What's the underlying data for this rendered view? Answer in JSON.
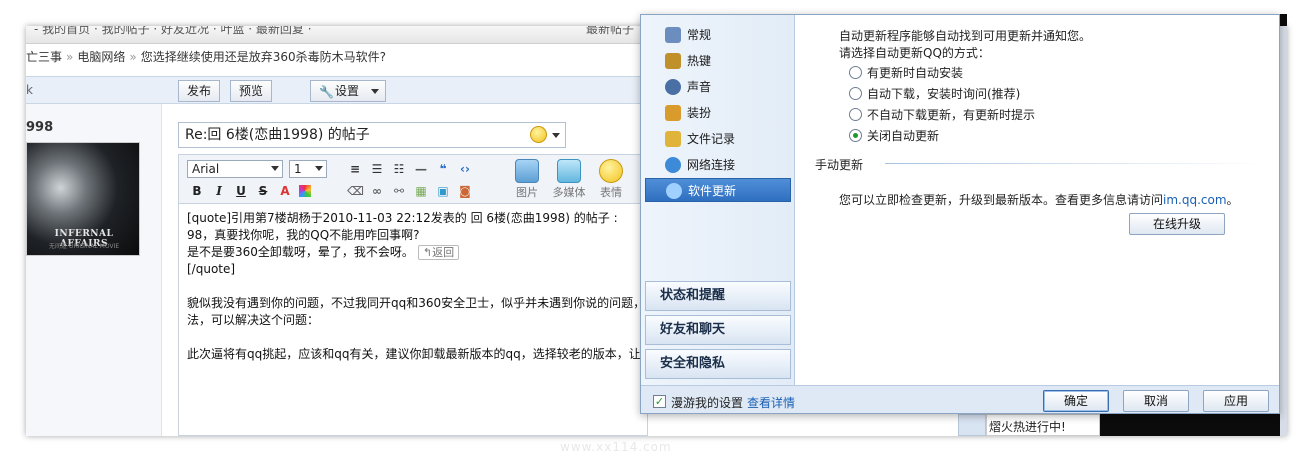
{
  "browser": {
    "topbar_text": "- 我的首页 · 我的帖子 · 好友近况 · 叶蓝 · 最新回复 ·",
    "topbar_right": "最新帖子"
  },
  "forum": {
    "breadcrumb": [
      "亡三事",
      "电脑网络",
      "您选择继续使用还是放弃360杀毒防木马软件?"
    ],
    "buttons": {
      "publish": "发布",
      "preview": "预览",
      "settings": "设置"
    },
    "left_marker": "k",
    "username": "998",
    "avatar_caption": "INFERNAL AFFAIRS",
    "avatar_sub": "无间道 ORIGINAL MOVIE",
    "subject": "Re:回 6楼(恋曲1998) 的帖子",
    "font_name": "Arial",
    "font_size": "1",
    "rich_icons": {
      "image": "图片",
      "media": "多媒体",
      "emoji": "表情"
    },
    "content_lines": [
      "[quote]引用第7楼胡杨于2010-11-03 22:12发表的 回 6楼(恋曲1998) 的帖子 :",
      "98，真要找你呢，我的QQ不能用咋回事啊?",
      "是不是要360全卸载呀，晕了，我不会呀。",
      "[/quote]",
      "",
      "貌似我没有遇到你的问题，不过我同开qq和360安全卫士，似乎并未遇到你说的问题，",
      "法，可以解决这个问题：",
      "",
      "此次逼将有qq挑起，应该和qq有关，建议你卸载最新版本的qq，选择较老的版本，让后"
    ],
    "back_label": "返回"
  },
  "dialog": {
    "nav_items": [
      {
        "label": "常规",
        "icon": "general-icon",
        "color": "#6c8ebf"
      },
      {
        "label": "热键",
        "icon": "hotkey-icon",
        "color": "#c0902a"
      },
      {
        "label": "声音",
        "icon": "sound-icon",
        "color": "#4a6fa5"
      },
      {
        "label": "装扮",
        "icon": "dress-icon",
        "color": "#d99b2b"
      },
      {
        "label": "文件记录",
        "icon": "folder-icon",
        "color": "#e0b33b"
      },
      {
        "label": "网络连接",
        "icon": "network-icon",
        "color": "#3c8ad8"
      },
      {
        "label": "软件更新",
        "icon": "update-icon",
        "color": "#2f6fc0"
      }
    ],
    "sections": [
      "状态和提醒",
      "好友和聊天",
      "安全和隐私"
    ],
    "auto_update_desc": "自动更新程序能够自动找到可用更新并通知您。",
    "choose_label": "请选择自动更新QQ的方式：",
    "options": [
      {
        "label": "有更新时自动安装",
        "selected": false
      },
      {
        "label": "自动下载，安装时询问(推荐)",
        "selected": false
      },
      {
        "label": "不自动下载更新，有更新时提示",
        "selected": false
      },
      {
        "label": "关闭自动更新",
        "selected": true
      }
    ],
    "manual_title": "手动更新",
    "manual_desc": "您可以立即检查更新，升级到最新版本。查看更多信息请访问",
    "manual_link": "im.qq.com",
    "manual_tail": "。",
    "online_upgrade": "在线升级",
    "roam_label": "漫游我的设置",
    "roam_checked": true,
    "roam_detail": "查看详情",
    "ok": "确定",
    "cancel": "取消",
    "apply": "应用"
  },
  "status_text": "熠火热进行中!",
  "watermark": "www.xx114.com"
}
